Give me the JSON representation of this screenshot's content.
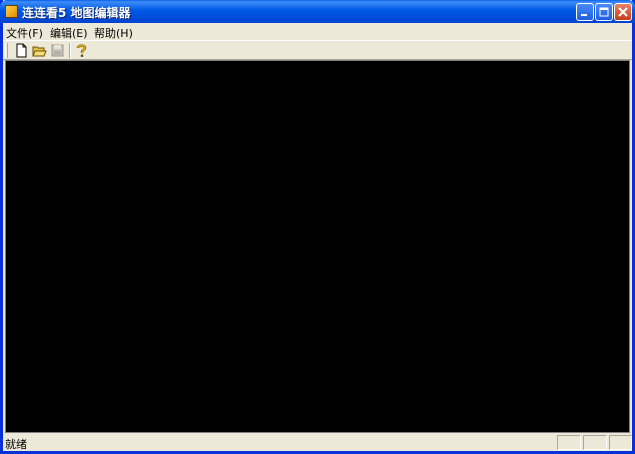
{
  "window": {
    "title": "连连看5 地图编辑器"
  },
  "menu": {
    "items": [
      {
        "label": "文件(F)"
      },
      {
        "label": "编辑(E)"
      },
      {
        "label": "帮助(H)"
      }
    ]
  },
  "toolbar": {
    "buttons": [
      {
        "icon": "new-document-icon"
      },
      {
        "icon": "open-folder-icon"
      },
      {
        "icon": "save-disk-icon",
        "enabled": false
      },
      {
        "icon": "help-icon"
      }
    ]
  },
  "status": {
    "text": "就绪"
  },
  "colors": {
    "titlebar": "#0058e6",
    "canvas": "#000000",
    "chrome": "#ece9d8"
  }
}
